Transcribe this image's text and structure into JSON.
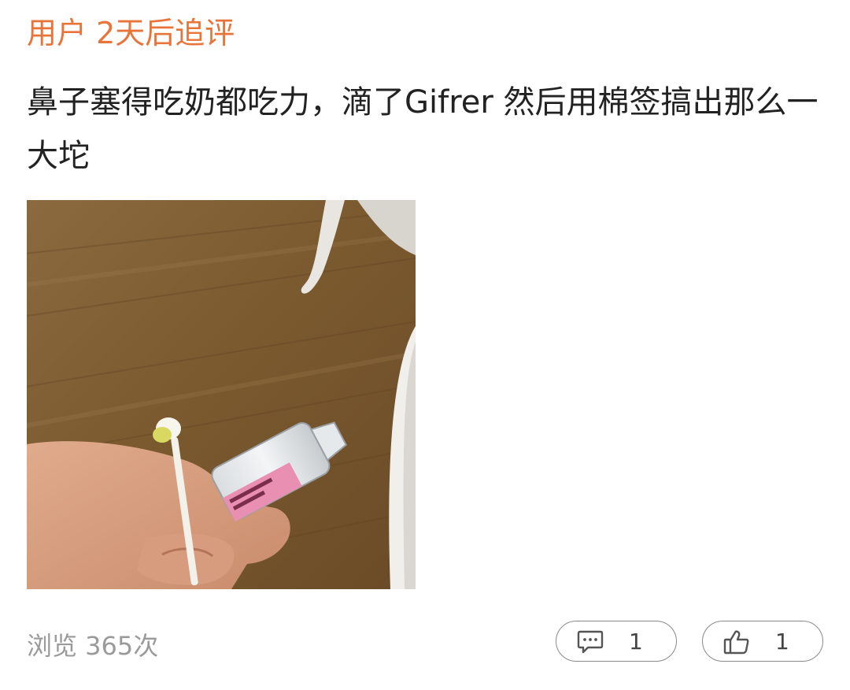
{
  "header": {
    "label": "用户 2天后追评"
  },
  "review": {
    "text": "鼻子塞得吃奶都吃力，滴了Gifrer 然后用棉签搞出那么一大坨",
    "photo": {
      "description": "photo-attachment",
      "vial_label_color": "#e88fb2"
    }
  },
  "footer": {
    "views_label": "浏览 365次",
    "comment_count": "1",
    "like_count": "1",
    "comment_icon": "comment-bubble-icon",
    "like_icon": "thumbs-up-icon"
  },
  "colors": {
    "accent": "#e8743a",
    "text": "#222222",
    "muted": "#9a9a9a",
    "border": "#8a8a8a"
  }
}
